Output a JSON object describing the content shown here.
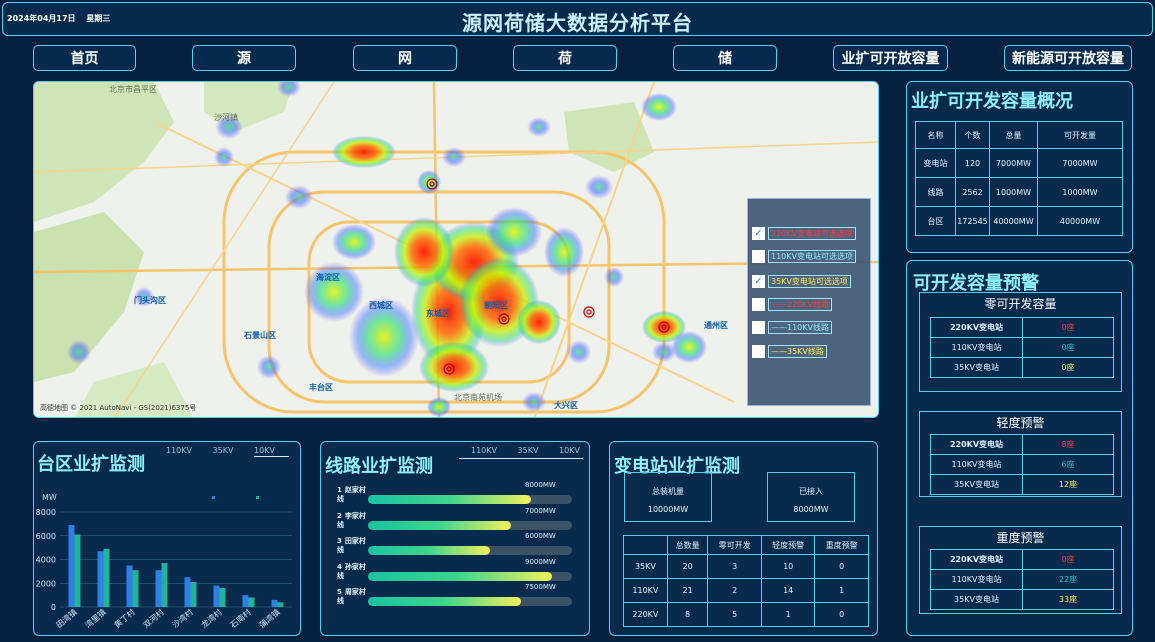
{
  "header": {
    "date": "2024年04月17日",
    "weekday": "星期三",
    "title": "源网荷储大数据分析平台"
  },
  "nav": [
    {
      "label": "首页"
    },
    {
      "label": "源"
    },
    {
      "label": "网"
    },
    {
      "label": "荷"
    },
    {
      "label": "储"
    },
    {
      "label": "业扩可开放容量"
    },
    {
      "label": "新能源可开放容量"
    }
  ],
  "map": {
    "copyright": "高德地图 © 2021 AutoNavi - GS(2021)6375号",
    "labels": [
      "北京市昌平区",
      "海淀区",
      "西城区",
      "东城区",
      "朝阳区",
      "丰台区",
      "石景山区",
      "门头沟区",
      "通州区",
      "大兴区",
      "沙河镇",
      "北京南苑机场"
    ],
    "layers": [
      {
        "label": "220KV变电站可选选项",
        "checked": true,
        "color": "#ff3b3b"
      },
      {
        "label": "110KV变电站可选选项",
        "checked": false,
        "color": "#8ff0ff"
      },
      {
        "label": "35KV变电站可选选项",
        "checked": true,
        "color": "#ffee55"
      },
      {
        "label": "——220KV线路",
        "checked": false,
        "color": "#ff3b3b"
      },
      {
        "label": "——110KV线路",
        "checked": false,
        "color": "#8ff0ff"
      },
      {
        "label": "——35KV线路",
        "checked": false,
        "color": "#ffee55"
      }
    ]
  },
  "capacity_overview": {
    "title": "业扩可开发容量概况",
    "headers": [
      "名称",
      "个数",
      "总量",
      "可开发量"
    ],
    "rows": [
      [
        "变电站",
        "120",
        "7000MW",
        "7000MW"
      ],
      [
        "线路",
        "2562",
        "1000MW",
        "1000MW"
      ],
      [
        "台区",
        "172545",
        "40000MW",
        "40000MW"
      ]
    ]
  },
  "capacity_warning": {
    "title": "可开发容量预警",
    "groups": [
      {
        "name": "零可开发容量",
        "rows": [
          [
            "220KV变电站",
            "0座",
            "#ff3b3b"
          ],
          [
            "110KV变电站",
            "0座",
            "#1fc6c6"
          ],
          [
            "35KV变电站",
            "0座",
            "#ffee55"
          ]
        ]
      },
      {
        "name": "轻度预警",
        "rows": [
          [
            "220KV变电站",
            "8座",
            "#ff3b3b"
          ],
          [
            "110KV变电站",
            "6座",
            "#1fc6c6"
          ],
          [
            "35KV变电站",
            "12座",
            "#ffee55"
          ]
        ]
      },
      {
        "name": "重度预警",
        "rows": [
          [
            "220KV变电站",
            "0座",
            "#ff3b3b"
          ],
          [
            "110KV变电站",
            "22座",
            "#1fc6c6"
          ],
          [
            "35KV变电站",
            "33座",
            "#ffee55"
          ]
        ]
      }
    ]
  },
  "district_monitor": {
    "title": "台区业扩监测",
    "tabs": [
      "110KV",
      "35KV",
      "10KV"
    ],
    "active_tab": 2,
    "chart_data": {
      "type": "bar",
      "ylabel": "MW",
      "ylim": [
        0,
        8000
      ],
      "yticks": [
        0,
        2000,
        4000,
        6000,
        8000
      ],
      "categories": [
        "田湾镇",
        "湾里镇",
        "黄丁村",
        "双河村",
        "沙湾村",
        "龙湾村",
        "石南村",
        "蒲湾镇"
      ],
      "series": [
        {
          "color": "#2e7fe6",
          "values": [
            6900,
            4700,
            3500,
            3100,
            2500,
            1800,
            1000,
            600
          ]
        },
        {
          "color": "#1fb39a",
          "values": [
            6100,
            4900,
            3100,
            3700,
            2100,
            1600,
            800,
            400
          ]
        }
      ]
    }
  },
  "line_monitor": {
    "title": "线路业扩监测",
    "tabs": [
      "110KV",
      "35KV",
      "10KV"
    ],
    "chart_data": {
      "type": "bar",
      "max": 10000,
      "items": [
        {
          "rank": "1",
          "name": "赵家村线",
          "value": 8000,
          "label": "8000MW"
        },
        {
          "rank": "2",
          "name": "李家村线",
          "value": 7000,
          "label": "7000MW"
        },
        {
          "rank": "3",
          "name": "田家村线",
          "value": 6000,
          "label": "6000MW"
        },
        {
          "rank": "4",
          "name": "孙家村线",
          "value": 9000,
          "label": "9000MW"
        },
        {
          "rank": "5",
          "name": "周家村线",
          "value": 7500,
          "label": "7500MW"
        }
      ]
    }
  },
  "substation_monitor": {
    "title": "变电站业扩监测",
    "total_label": "总装机量",
    "total_value": "10000MW",
    "connected_label": "已接入",
    "connected_value": "8000MW",
    "headers": [
      "",
      "总数量",
      "零可开发",
      "轻度预警",
      "重度预警"
    ],
    "rows": [
      [
        "35KV",
        "20",
        "3",
        "10",
        "0"
      ],
      [
        "110KV",
        "21",
        "2",
        "14",
        "1"
      ],
      [
        "220KV",
        "8",
        "5",
        "1",
        "0"
      ]
    ]
  }
}
